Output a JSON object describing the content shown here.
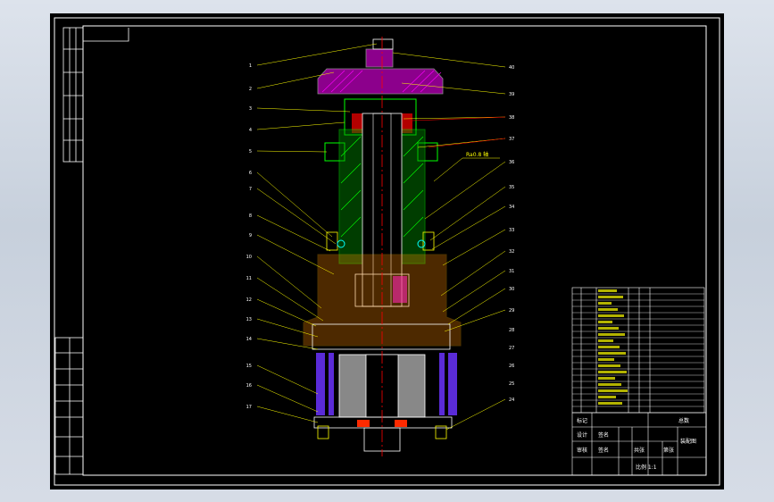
{
  "viewport": {
    "background": "#000000",
    "frame_color": "#ffffff"
  },
  "colors": {
    "leader": "#ffff00",
    "centerline": "#ff0000",
    "outline": "#ffffff",
    "hatch_green": "#00ff00",
    "hatch_magenta": "#ff00ff",
    "purple": "#5a2bd8",
    "red_fill": "#ff2a00",
    "yellow": "#ffff00",
    "table_text": "#ffff00"
  },
  "part_labels_left": [
    "1",
    "2",
    "3",
    "4",
    "5",
    "6",
    "7",
    "8",
    "9",
    "10",
    "11",
    "12",
    "13",
    "14",
    "15",
    "16",
    "17"
  ],
  "part_labels_right": [
    "40",
    "39",
    "38",
    "37",
    "36",
    "35",
    "34",
    "33",
    "32",
    "31",
    "30",
    "29",
    "28",
    "27",
    "26",
    "25",
    "24"
  ],
  "callout": "Ra0.8 轴",
  "title_block": {
    "row1": [
      "标记",
      "",
      "",
      "",
      "",
      "",
      "总数"
    ],
    "row2": [
      "设计",
      "签名",
      "",
      "",
      "装配图"
    ],
    "row3": [
      "审核",
      "签名",
      "共张",
      "第张"
    ],
    "row4": [
      "",
      "",
      "比例 1:1"
    ]
  }
}
